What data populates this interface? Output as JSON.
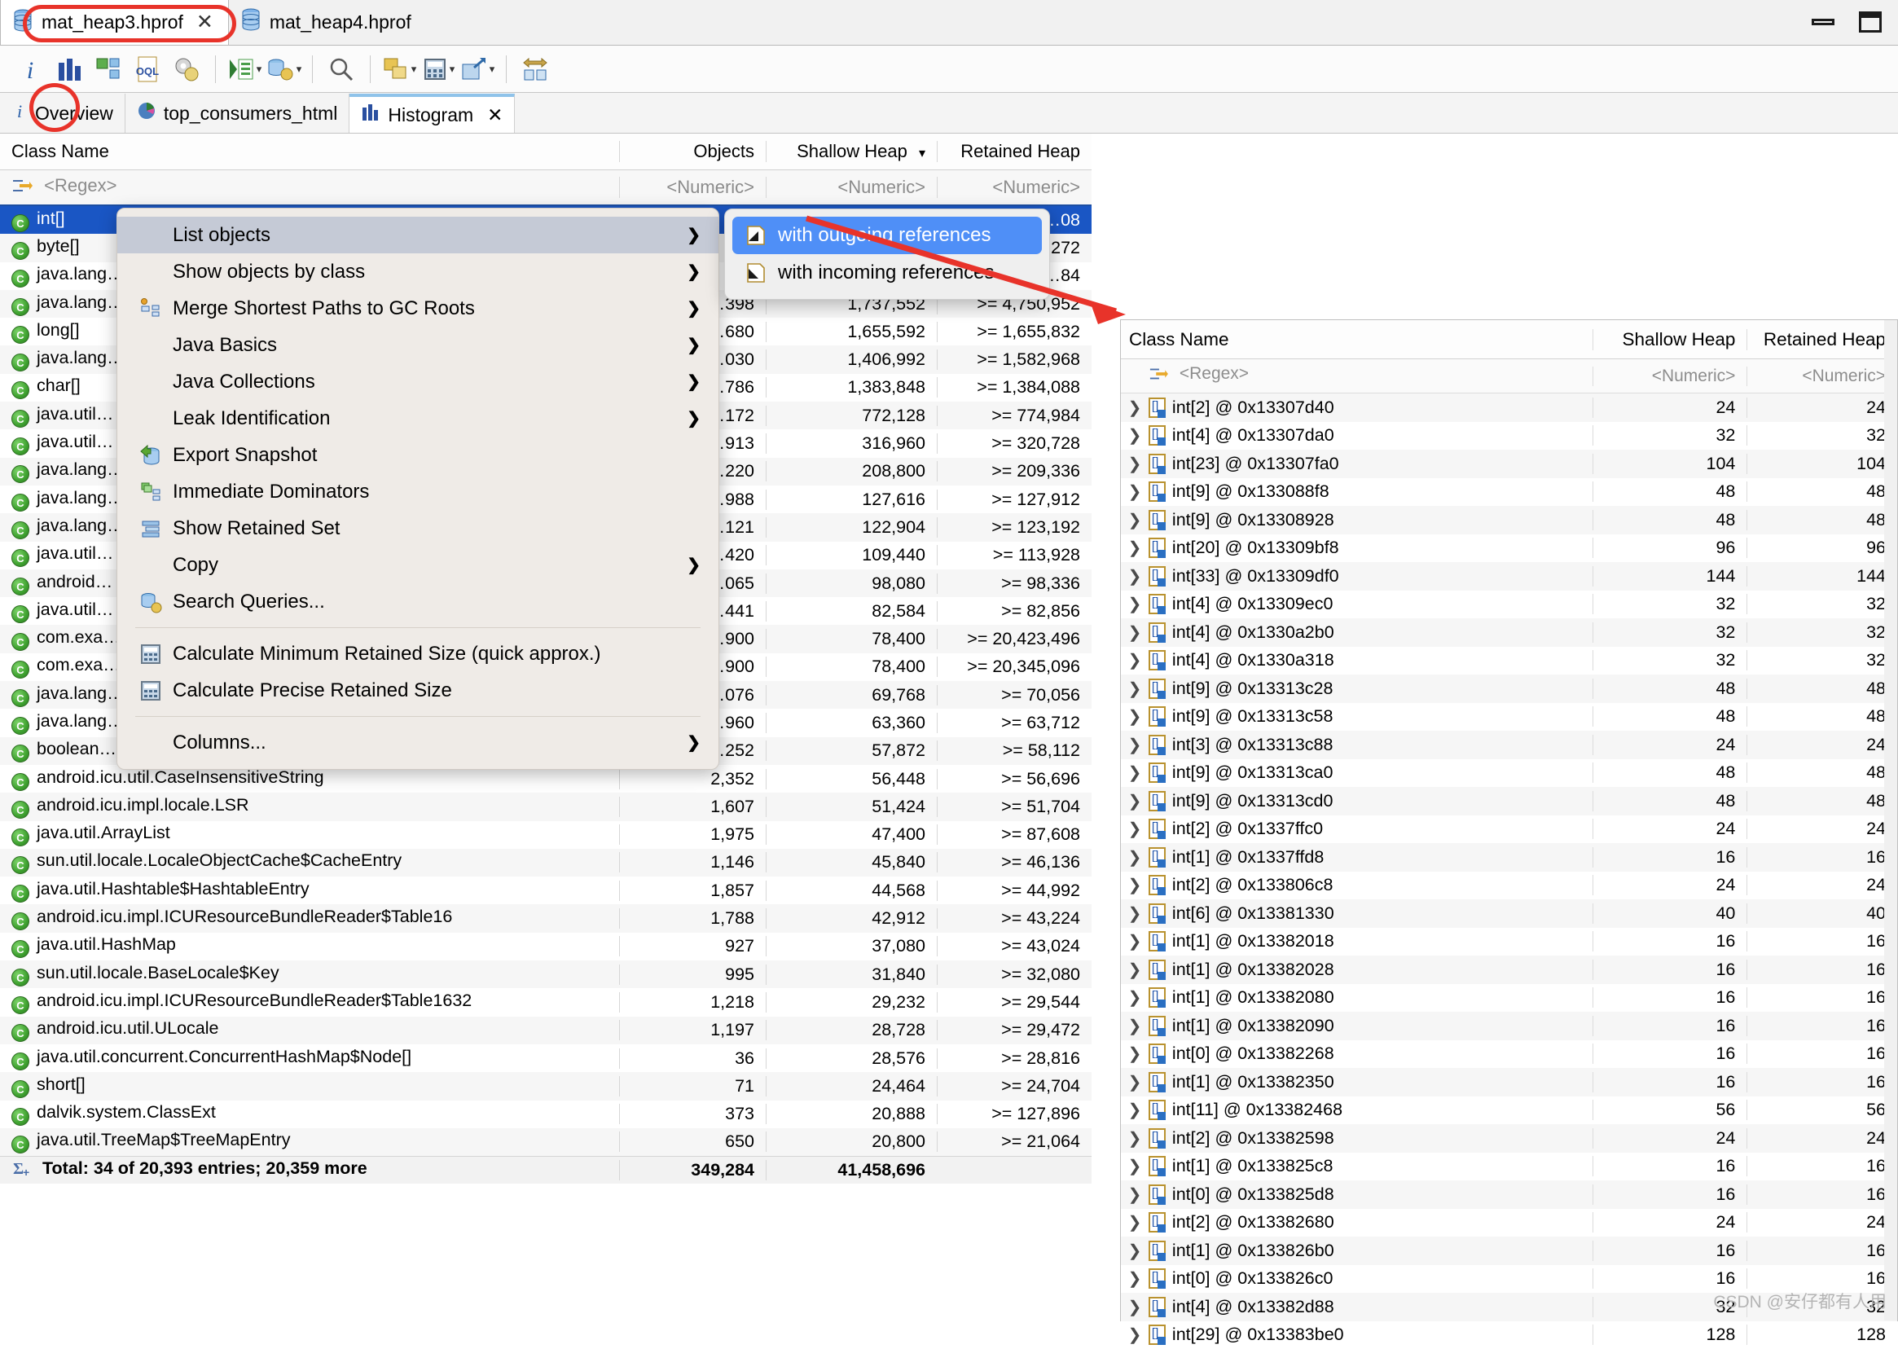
{
  "window": {
    "editor_tabs": [
      {
        "label": "mat_heap3.hprof",
        "active": true,
        "closable": true
      },
      {
        "label": "mat_heap4.hprof",
        "active": false,
        "closable": false
      }
    ],
    "controls": {
      "minimize": "minimize",
      "maximize": "maximize"
    }
  },
  "toolbar": {
    "items": [
      {
        "name": "overview-info",
        "icon": "info-icon"
      },
      {
        "name": "histogram",
        "icon": "histogram-icon"
      },
      {
        "name": "dominator-tree",
        "icon": "dominator-tree-icon"
      },
      {
        "name": "oql",
        "icon": "oql-icon"
      },
      {
        "name": "leak-suspects",
        "icon": "gears-icon"
      },
      {
        "name": "run-expert-system",
        "icon": "run-query-icon",
        "caret": true
      },
      {
        "name": "open-query-browser",
        "icon": "heap-query-icon",
        "caret": true
      },
      {
        "name": "find-object",
        "icon": "search-icon"
      },
      {
        "name": "group-by",
        "icon": "group-icon",
        "caret": true
      },
      {
        "name": "calculator",
        "icon": "calculator-icon",
        "caret": true
      },
      {
        "name": "export",
        "icon": "export-icon",
        "caret": true
      },
      {
        "name": "compare-snapshots",
        "icon": "compare-icon"
      }
    ],
    "help_icon": "help-icon"
  },
  "view_tabs": [
    {
      "label": "Overview",
      "icon": "info-icon",
      "active": false,
      "closable": false
    },
    {
      "label": "top_consumers_html",
      "icon": "pie-chart-icon",
      "active": false,
      "closable": false
    },
    {
      "label": "Histogram",
      "icon": "histogram-icon",
      "active": true,
      "closable": true
    }
  ],
  "histogram": {
    "columns": [
      "Class Name",
      "Objects",
      "Shallow Heap",
      "Retained Heap"
    ],
    "sorted_column": "Shallow Heap",
    "sort_icon": "chevron-down-icon",
    "filters": [
      "<Regex>",
      "<Numeric>",
      "<Numeric>",
      "<Numeric>"
    ],
    "filter_icon": "regex-filter-icon",
    "rows": [
      {
        "class": "int[]",
        "objects": "",
        "shallow": "",
        "retained": "…08",
        "selected": true
      },
      {
        "class": "byte[]",
        "objects": "",
        "shallow": "",
        "retained": "…272"
      },
      {
        "class": "java.lang…",
        "objects": "",
        "shallow": "",
        "retained": "…84"
      },
      {
        "class": "java.lang…",
        "objects": "…398",
        "shallow": "1,737,552",
        "retained": ">= 4,750,952"
      },
      {
        "class": "long[]",
        "objects": "…680",
        "shallow": "1,655,592",
        "retained": ">= 1,655,832"
      },
      {
        "class": "java.lang…",
        "objects": "…030",
        "shallow": "1,406,992",
        "retained": ">= 1,582,968"
      },
      {
        "class": "char[]",
        "objects": "…786",
        "shallow": "1,383,848",
        "retained": ">= 1,384,088"
      },
      {
        "class": "java.util…",
        "objects": "…172",
        "shallow": "772,128",
        "retained": ">= 774,984"
      },
      {
        "class": "java.util…",
        "objects": "…913",
        "shallow": "316,960",
        "retained": ">= 320,728"
      },
      {
        "class": "java.lang…",
        "objects": "…220",
        "shallow": "208,800",
        "retained": ">= 209,336"
      },
      {
        "class": "java.lang…",
        "objects": "…988",
        "shallow": "127,616",
        "retained": ">= 127,912"
      },
      {
        "class": "java.lang…",
        "objects": "…121",
        "shallow": "122,904",
        "retained": ">= 123,192"
      },
      {
        "class": "java.util…",
        "objects": "…420",
        "shallow": "109,440",
        "retained": ">= 113,928"
      },
      {
        "class": "android…",
        "objects": "…065",
        "shallow": "98,080",
        "retained": ">= 98,336"
      },
      {
        "class": "java.util…",
        "objects": "…441",
        "shallow": "82,584",
        "retained": ">= 82,856"
      },
      {
        "class": "com.exa…",
        "objects": "…900",
        "shallow": "78,400",
        "retained": ">= 20,423,496"
      },
      {
        "class": "com.exa…",
        "objects": "…900",
        "shallow": "78,400",
        "retained": ">= 20,345,096"
      },
      {
        "class": "java.lang…",
        "objects": "…076",
        "shallow": "69,768",
        "retained": ">= 70,056"
      },
      {
        "class": "java.lang…",
        "objects": "…960",
        "shallow": "63,360",
        "retained": ">= 63,712"
      },
      {
        "class": "boolean…",
        "objects": "…252",
        "shallow": "57,872",
        "retained": ">= 58,112"
      },
      {
        "class": "android.icu.util.CaseInsensitiveString",
        "objects": "2,352",
        "shallow": "56,448",
        "retained": ">= 56,696"
      },
      {
        "class": "android.icu.impl.locale.LSR",
        "objects": "1,607",
        "shallow": "51,424",
        "retained": ">= 51,704"
      },
      {
        "class": "java.util.ArrayList",
        "objects": "1,975",
        "shallow": "47,400",
        "retained": ">= 87,608"
      },
      {
        "class": "sun.util.locale.LocaleObjectCache$CacheEntry",
        "objects": "1,146",
        "shallow": "45,840",
        "retained": ">= 46,136"
      },
      {
        "class": "java.util.Hashtable$HashtableEntry",
        "objects": "1,857",
        "shallow": "44,568",
        "retained": ">= 44,992"
      },
      {
        "class": "android.icu.impl.ICUResourceBundleReader$Table16",
        "objects": "1,788",
        "shallow": "42,912",
        "retained": ">= 43,224"
      },
      {
        "class": "java.util.HashMap",
        "objects": "927",
        "shallow": "37,080",
        "retained": ">= 43,024"
      },
      {
        "class": "sun.util.locale.BaseLocale$Key",
        "objects": "995",
        "shallow": "31,840",
        "retained": ">= 32,080"
      },
      {
        "class": "android.icu.impl.ICUResourceBundleReader$Table1632",
        "objects": "1,218",
        "shallow": "29,232",
        "retained": ">= 29,544"
      },
      {
        "class": "android.icu.util.ULocale",
        "objects": "1,197",
        "shallow": "28,728",
        "retained": ">= 29,472"
      },
      {
        "class": "java.util.concurrent.ConcurrentHashMap$Node[]",
        "objects": "36",
        "shallow": "28,576",
        "retained": ">= 28,816"
      },
      {
        "class": "short[]",
        "objects": "71",
        "shallow": "24,464",
        "retained": ">= 24,704"
      },
      {
        "class": "dalvik.system.ClassExt",
        "objects": "373",
        "shallow": "20,888",
        "retained": ">= 127,896"
      },
      {
        "class": "java.util.TreeMap$TreeMapEntry",
        "objects": "650",
        "shallow": "20,800",
        "retained": ">= 21,064"
      }
    ],
    "total_row": {
      "label": "Total: 34 of 20,393 entries; 20,359 more",
      "icon": "sum-icon",
      "objects": "349,284",
      "shallow": "41,458,696",
      "retained": ""
    }
  },
  "context_menu": {
    "items": [
      {
        "label": "List objects",
        "icon": "",
        "submenu": true,
        "highlighted": true
      },
      {
        "label": "Show objects by class",
        "icon": "",
        "submenu": true
      },
      {
        "label": "Merge Shortest Paths to GC Roots",
        "icon": "merge-paths-icon",
        "submenu": true
      },
      {
        "label": "Java Basics",
        "icon": "",
        "submenu": true
      },
      {
        "label": "Java Collections",
        "icon": "",
        "submenu": true
      },
      {
        "label": "Leak Identification",
        "icon": "",
        "submenu": true
      },
      {
        "label": "Export Snapshot",
        "icon": "export-snapshot-icon",
        "submenu": false
      },
      {
        "label": "Immediate Dominators",
        "icon": "dominators-icon",
        "submenu": false
      },
      {
        "label": "Show Retained Set",
        "icon": "retained-set-icon",
        "submenu": false
      },
      {
        "label": "Copy",
        "icon": "",
        "submenu": true
      },
      {
        "label": "Search Queries...",
        "icon": "search-queries-icon",
        "submenu": false
      },
      {
        "separator": true
      },
      {
        "label": "Calculate Minimum Retained Size (quick approx.)",
        "icon": "calculator-icon",
        "submenu": false
      },
      {
        "label": "Calculate Precise Retained Size",
        "icon": "calculator-icon",
        "submenu": false
      },
      {
        "separator": true
      },
      {
        "label": "Columns...",
        "icon": "",
        "submenu": true
      }
    ],
    "submenu": {
      "items": [
        {
          "label": "with outgoing references",
          "icon": "outgoing-refs-icon",
          "selected": true
        },
        {
          "label": "with incoming references",
          "icon": "incoming-refs-icon",
          "selected": false
        }
      ]
    }
  },
  "object_list": {
    "columns": [
      "Class Name",
      "Shallow Heap",
      "Retained Heap"
    ],
    "filters": [
      "<Regex>",
      "<Numeric>",
      "<Numeric>"
    ],
    "filter_icon": "regex-filter-icon",
    "rows": [
      {
        "class": "int[2] @ 0x13307d40",
        "shallow": "24",
        "retained": "24"
      },
      {
        "class": "int[4] @ 0x13307da0",
        "shallow": "32",
        "retained": "32"
      },
      {
        "class": "int[23] @ 0x13307fa0",
        "shallow": "104",
        "retained": "104"
      },
      {
        "class": "int[9] @ 0x133088f8",
        "shallow": "48",
        "retained": "48"
      },
      {
        "class": "int[9] @ 0x13308928",
        "shallow": "48",
        "retained": "48"
      },
      {
        "class": "int[20] @ 0x13309bf8",
        "shallow": "96",
        "retained": "96"
      },
      {
        "class": "int[33] @ 0x13309df0",
        "shallow": "144",
        "retained": "144"
      },
      {
        "class": "int[4] @ 0x13309ec0",
        "shallow": "32",
        "retained": "32"
      },
      {
        "class": "int[4] @ 0x1330a2b0",
        "shallow": "32",
        "retained": "32"
      },
      {
        "class": "int[4] @ 0x1330a318",
        "shallow": "32",
        "retained": "32"
      },
      {
        "class": "int[9] @ 0x13313c28",
        "shallow": "48",
        "retained": "48"
      },
      {
        "class": "int[9] @ 0x13313c58",
        "shallow": "48",
        "retained": "48"
      },
      {
        "class": "int[3] @ 0x13313c88",
        "shallow": "24",
        "retained": "24"
      },
      {
        "class": "int[9] @ 0x13313ca0",
        "shallow": "48",
        "retained": "48"
      },
      {
        "class": "int[9] @ 0x13313cd0",
        "shallow": "48",
        "retained": "48"
      },
      {
        "class": "int[2] @ 0x1337ffc0",
        "shallow": "24",
        "retained": "24"
      },
      {
        "class": "int[1] @ 0x1337ffd8",
        "shallow": "16",
        "retained": "16"
      },
      {
        "class": "int[2] @ 0x133806c8",
        "shallow": "24",
        "retained": "24"
      },
      {
        "class": "int[6] @ 0x13381330",
        "shallow": "40",
        "retained": "40"
      },
      {
        "class": "int[1] @ 0x13382018",
        "shallow": "16",
        "retained": "16"
      },
      {
        "class": "int[1] @ 0x13382028",
        "shallow": "16",
        "retained": "16"
      },
      {
        "class": "int[1] @ 0x13382080",
        "shallow": "16",
        "retained": "16"
      },
      {
        "class": "int[1] @ 0x13382090",
        "shallow": "16",
        "retained": "16"
      },
      {
        "class": "int[0] @ 0x13382268",
        "shallow": "16",
        "retained": "16"
      },
      {
        "class": "int[1] @ 0x13382350",
        "shallow": "16",
        "retained": "16"
      },
      {
        "class": "int[11] @ 0x13382468",
        "shallow": "56",
        "retained": "56"
      },
      {
        "class": "int[2] @ 0x13382598",
        "shallow": "24",
        "retained": "24"
      },
      {
        "class": "int[1] @ 0x133825c8",
        "shallow": "16",
        "retained": "16"
      },
      {
        "class": "int[0] @ 0x133825d8",
        "shallow": "16",
        "retained": "16"
      },
      {
        "class": "int[2] @ 0x13382680",
        "shallow": "24",
        "retained": "24"
      },
      {
        "class": "int[1] @ 0x133826b0",
        "shallow": "16",
        "retained": "16"
      },
      {
        "class": "int[0] @ 0x133826c0",
        "shallow": "16",
        "retained": "16"
      },
      {
        "class": "int[4] @ 0x13382d88",
        "shallow": "32",
        "retained": "32"
      },
      {
        "class": "int[29] @ 0x13383be0",
        "shallow": "128",
        "retained": "128"
      }
    ]
  },
  "annotation": {
    "arrow_color": "#e8332a",
    "highlight_color": "#e8332a"
  },
  "watermark": "CSDN @安仔都有人用"
}
